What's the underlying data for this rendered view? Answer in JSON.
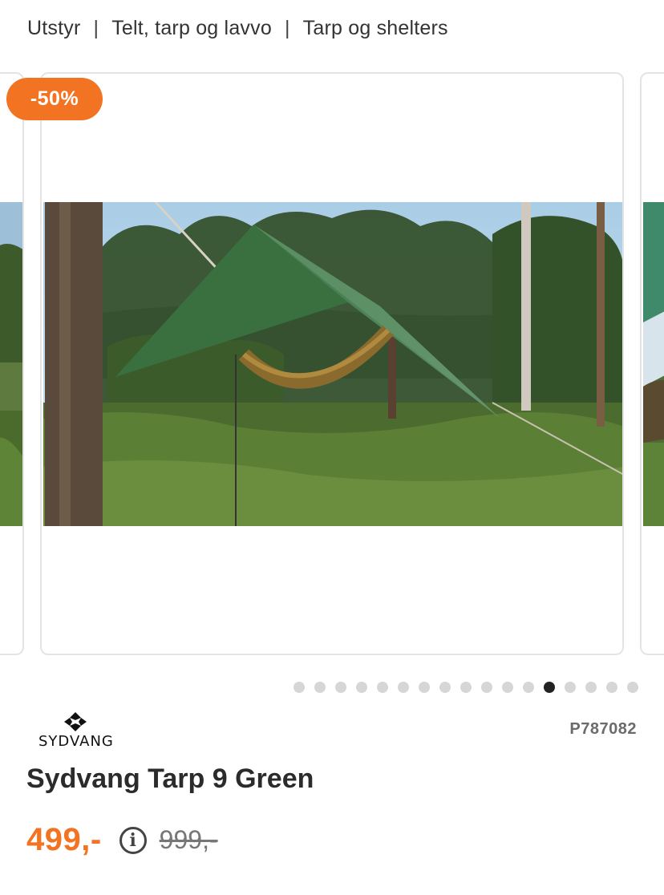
{
  "breadcrumb": {
    "items": [
      "Utstyr",
      "Telt, tarp og lavvo",
      "Tarp og shelters"
    ],
    "separator": "|"
  },
  "gallery": {
    "discount_badge": "-50%",
    "image_alt": "Green tarp pitched over a hammock in a pine forest",
    "dot_count": 17,
    "active_dot_index": 12
  },
  "product": {
    "brand": "SYDVANG",
    "sku": "P787082",
    "title": "Sydvang Tarp 9 Green",
    "price": "499,-",
    "old_price": "999,-",
    "info_icon": "info-icon"
  },
  "colors": {
    "accent": "#f27422",
    "active_dot": "#222222",
    "inactive_dot": "#d6d6d6"
  }
}
